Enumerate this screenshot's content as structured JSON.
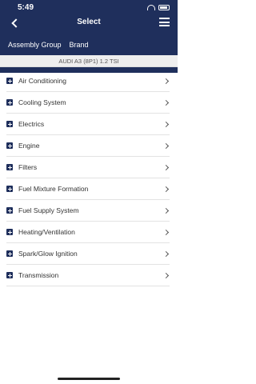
{
  "status_bar": {
    "time": "5:49"
  },
  "header": {
    "title": "Select"
  },
  "tabs": [
    {
      "label": "Assembly Group"
    },
    {
      "label": "Brand"
    }
  ],
  "vehicle": {
    "label": "AUDI A3 (8P1) 1.2 TSI"
  },
  "list": {
    "items": [
      {
        "label": "Air Conditioning"
      },
      {
        "label": "Cooling System"
      },
      {
        "label": "Electrics"
      },
      {
        "label": "Engine"
      },
      {
        "label": "Filters"
      },
      {
        "label": "Fuel Mixture Formation"
      },
      {
        "label": "Fuel Supply System"
      },
      {
        "label": "Heating/Ventilation"
      },
      {
        "label": "Spark/Glow Ignition"
      },
      {
        "label": "Transmission"
      }
    ]
  },
  "colors": {
    "header_bg": "#1f2f5c",
    "accent": "#1f2f5c"
  },
  "icons": {
    "back": "chevron-left-icon",
    "menu": "hamburger-menu-icon",
    "expand": "plus-box-icon",
    "row": "chevron-right-icon"
  }
}
